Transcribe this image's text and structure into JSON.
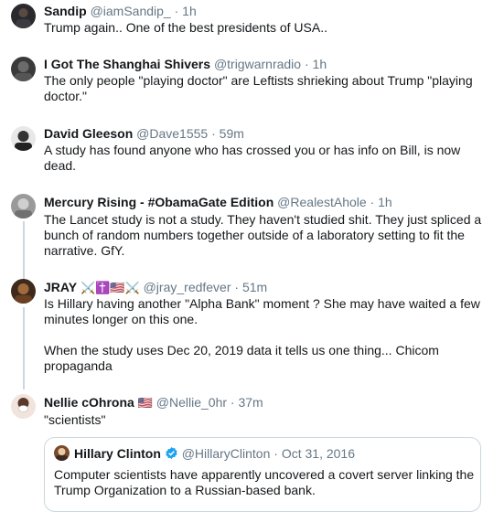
{
  "tweets": [
    {
      "name": "Sandip",
      "handle": "@iamSandip_",
      "time": "1h",
      "text": "Trump again.. One of the best presidents of USA.."
    },
    {
      "name": "I Got The Shanghai Shivers",
      "handle": "@trigwarnradio",
      "time": "1h",
      "text": "The only people \"playing doctor\" are Leftists shrieking about Trump \"playing doctor.\""
    },
    {
      "name": "David Gleeson",
      "handle": "@Dave1555",
      "time": "59m",
      "text": "A study has found anyone who has crossed you or has info on Bill,  is now dead."
    },
    {
      "name": "Mercury Rising - #ObamaGate Edition",
      "handle": "@RealestAhole",
      "time": "1h",
      "text": "The Lancet study is not a study. They haven't studied shit. They just spliced a bunch of random numbers together outside of a laboratory setting to fit the narrative. GfY."
    },
    {
      "name": "JRAY",
      "name_emoji": "⚔️✝️🇺🇸⚔️",
      "handle": "@jray_redfever",
      "time": "51m",
      "text": "Is Hillary having another \"Alpha Bank\" moment ?  She may have waited a few minutes longer on this one.",
      "text2": "When the study uses Dec 20, 2019 data it tells us one thing... Chicom propaganda"
    },
    {
      "name": "Nellie cOhrona",
      "name_emoji": "🇺🇸",
      "handle": "@Nellie_0hr",
      "time": "37m",
      "text": "\"scientists\""
    }
  ],
  "quoted": {
    "name": "Hillary Clinton",
    "handle": "@HillaryClinton",
    "time": "Oct 31, 2016",
    "text": "Computer scientists have apparently uncovered a covert server linking the Trump Organization to a Russian-based bank."
  },
  "separator": "·",
  "colors": {
    "muted": "#657786",
    "border": "#ccd6dd",
    "verified": "#1da1f2"
  }
}
